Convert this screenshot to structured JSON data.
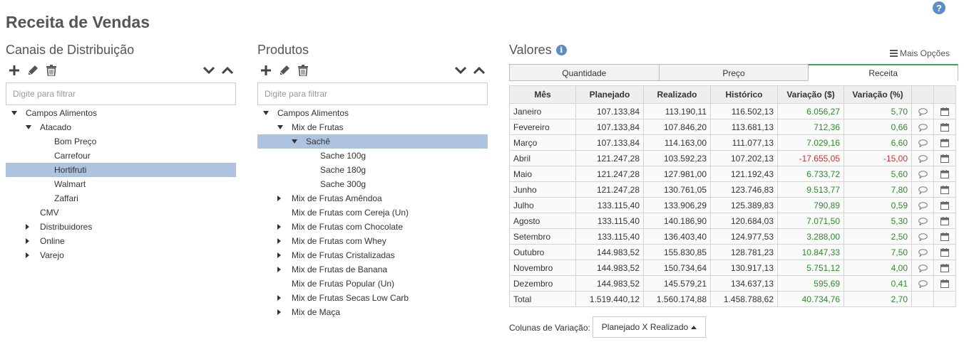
{
  "page": {
    "title": "Receita de Vendas"
  },
  "help": {
    "icon": "question-circle-icon",
    "label": "?"
  },
  "canais": {
    "title": "Canais de Distribuição",
    "filter_placeholder": "Digite para filtrar",
    "tree": [
      {
        "label": "Campos Alimentos",
        "expand": "down",
        "selected": false
      },
      {
        "label": "Atacado",
        "expand": "down",
        "selected": false
      },
      {
        "label": "Bom Preço",
        "expand": "none",
        "selected": false
      },
      {
        "label": "Carrefour",
        "expand": "none",
        "selected": false
      },
      {
        "label": "Hortifruti",
        "expand": "none",
        "selected": true
      },
      {
        "label": "Walmart",
        "expand": "none",
        "selected": false
      },
      {
        "label": "Zaffari",
        "expand": "none",
        "selected": false
      },
      {
        "label": "CMV",
        "expand": "none",
        "selected": false
      },
      {
        "label": "Distribuidores",
        "expand": "right",
        "selected": false
      },
      {
        "label": "Online",
        "expand": "right",
        "selected": false
      },
      {
        "label": "Varejo",
        "expand": "right",
        "selected": false
      }
    ]
  },
  "produtos": {
    "title": "Produtos",
    "filter_placeholder": "Digite para filtrar",
    "tree": [
      {
        "label": "Campos Alimentos",
        "expand": "down",
        "selected": false
      },
      {
        "label": "Mix de Frutas",
        "expand": "down",
        "selected": false
      },
      {
        "label": "Sachê",
        "expand": "down",
        "selected": true
      },
      {
        "label": "Sache 100g",
        "expand": "none",
        "selected": false
      },
      {
        "label": "Sache 180g",
        "expand": "none",
        "selected": false
      },
      {
        "label": "Sache 300g",
        "expand": "none",
        "selected": false
      },
      {
        "label": "Mix de Frutas Amêndoa",
        "expand": "right",
        "selected": false
      },
      {
        "label": "Mix de Frutas com Cereja (Un)",
        "expand": "none",
        "selected": false
      },
      {
        "label": "Mix de Frutas com Chocolate",
        "expand": "right",
        "selected": false
      },
      {
        "label": "Mix de Frutas com Whey",
        "expand": "right",
        "selected": false
      },
      {
        "label": "Mix de Frutas Cristalizadas",
        "expand": "right",
        "selected": false
      },
      {
        "label": "Mix de Frutas de Banana",
        "expand": "right",
        "selected": false
      },
      {
        "label": "Mix de Frutas Popular (Un)",
        "expand": "none",
        "selected": false
      },
      {
        "label": "Mix de Frutas Secas Low Carb",
        "expand": "right",
        "selected": false
      },
      {
        "label": "Mix de Maça",
        "expand": "right",
        "selected": false
      }
    ]
  },
  "valores": {
    "title": "Valores",
    "info_icon": "info-circle-icon",
    "mais_opcoes": "Mais Opções",
    "tabs": [
      {
        "label": "Quantidade",
        "active": false
      },
      {
        "label": "Preço",
        "active": false
      },
      {
        "label": "Receita",
        "active": true
      }
    ],
    "columns": [
      "Mês",
      "Planejado",
      "Realizado",
      "Histórico",
      "Variação ($)",
      "Variação (%)"
    ],
    "rows": [
      [
        "Janeiro",
        "107.133,84",
        "113.190,11",
        "116.502,13",
        "6.056,27",
        "5,70"
      ],
      [
        "Fevereiro",
        "107.133,84",
        "107.846,20",
        "113.681,13",
        "712,36",
        "0,66"
      ],
      [
        "Março",
        "107.133,84",
        "114.163,00",
        "111.077,13",
        "7.029,16",
        "6,60"
      ],
      [
        "Abril",
        "121.247,28",
        "103.592,23",
        "107.202,13",
        "-17.655,05",
        "-15,00"
      ],
      [
        "Maio",
        "121.247,28",
        "127.981,00",
        "121.192,43",
        "6.733,72",
        "5,60"
      ],
      [
        "Junho",
        "121.247,28",
        "130.761,05",
        "123.746,83",
        "9.513,77",
        "7,80"
      ],
      [
        "Julho",
        "133.115,40",
        "133.906,29",
        "125.389,83",
        "790,89",
        "0,59"
      ],
      [
        "Agosto",
        "133.115,40",
        "140.186,90",
        "120.684,03",
        "7.071,50",
        "5,30"
      ],
      [
        "Setembro",
        "133.115,40",
        "136.403,40",
        "124.977,53",
        "3.288,00",
        "2,50"
      ],
      [
        "Outubro",
        "144.983,52",
        "155.830,85",
        "128.781,23",
        "10.847,33",
        "7,50"
      ],
      [
        "Novembro",
        "144.983,52",
        "150.734,64",
        "130.917,13",
        "5.751,12",
        "4,00"
      ],
      [
        "Dezembro",
        "144.983,52",
        "145.579,21",
        "134.637,13",
        "595,69",
        "0,41"
      ]
    ],
    "total": [
      "Total",
      "1.519.440,12",
      "1.560.174,88",
      "1.458.788,62",
      "40.734,76",
      "2,70"
    ],
    "colors": {
      "positive": "#2e8b2e",
      "negative": "#d93030",
      "selected": "#adc3e0",
      "active_tab": "#3da35a"
    }
  },
  "colunas_variacao": {
    "label": "Colunas de Variação:",
    "selected": "Planejado X Realizado"
  }
}
